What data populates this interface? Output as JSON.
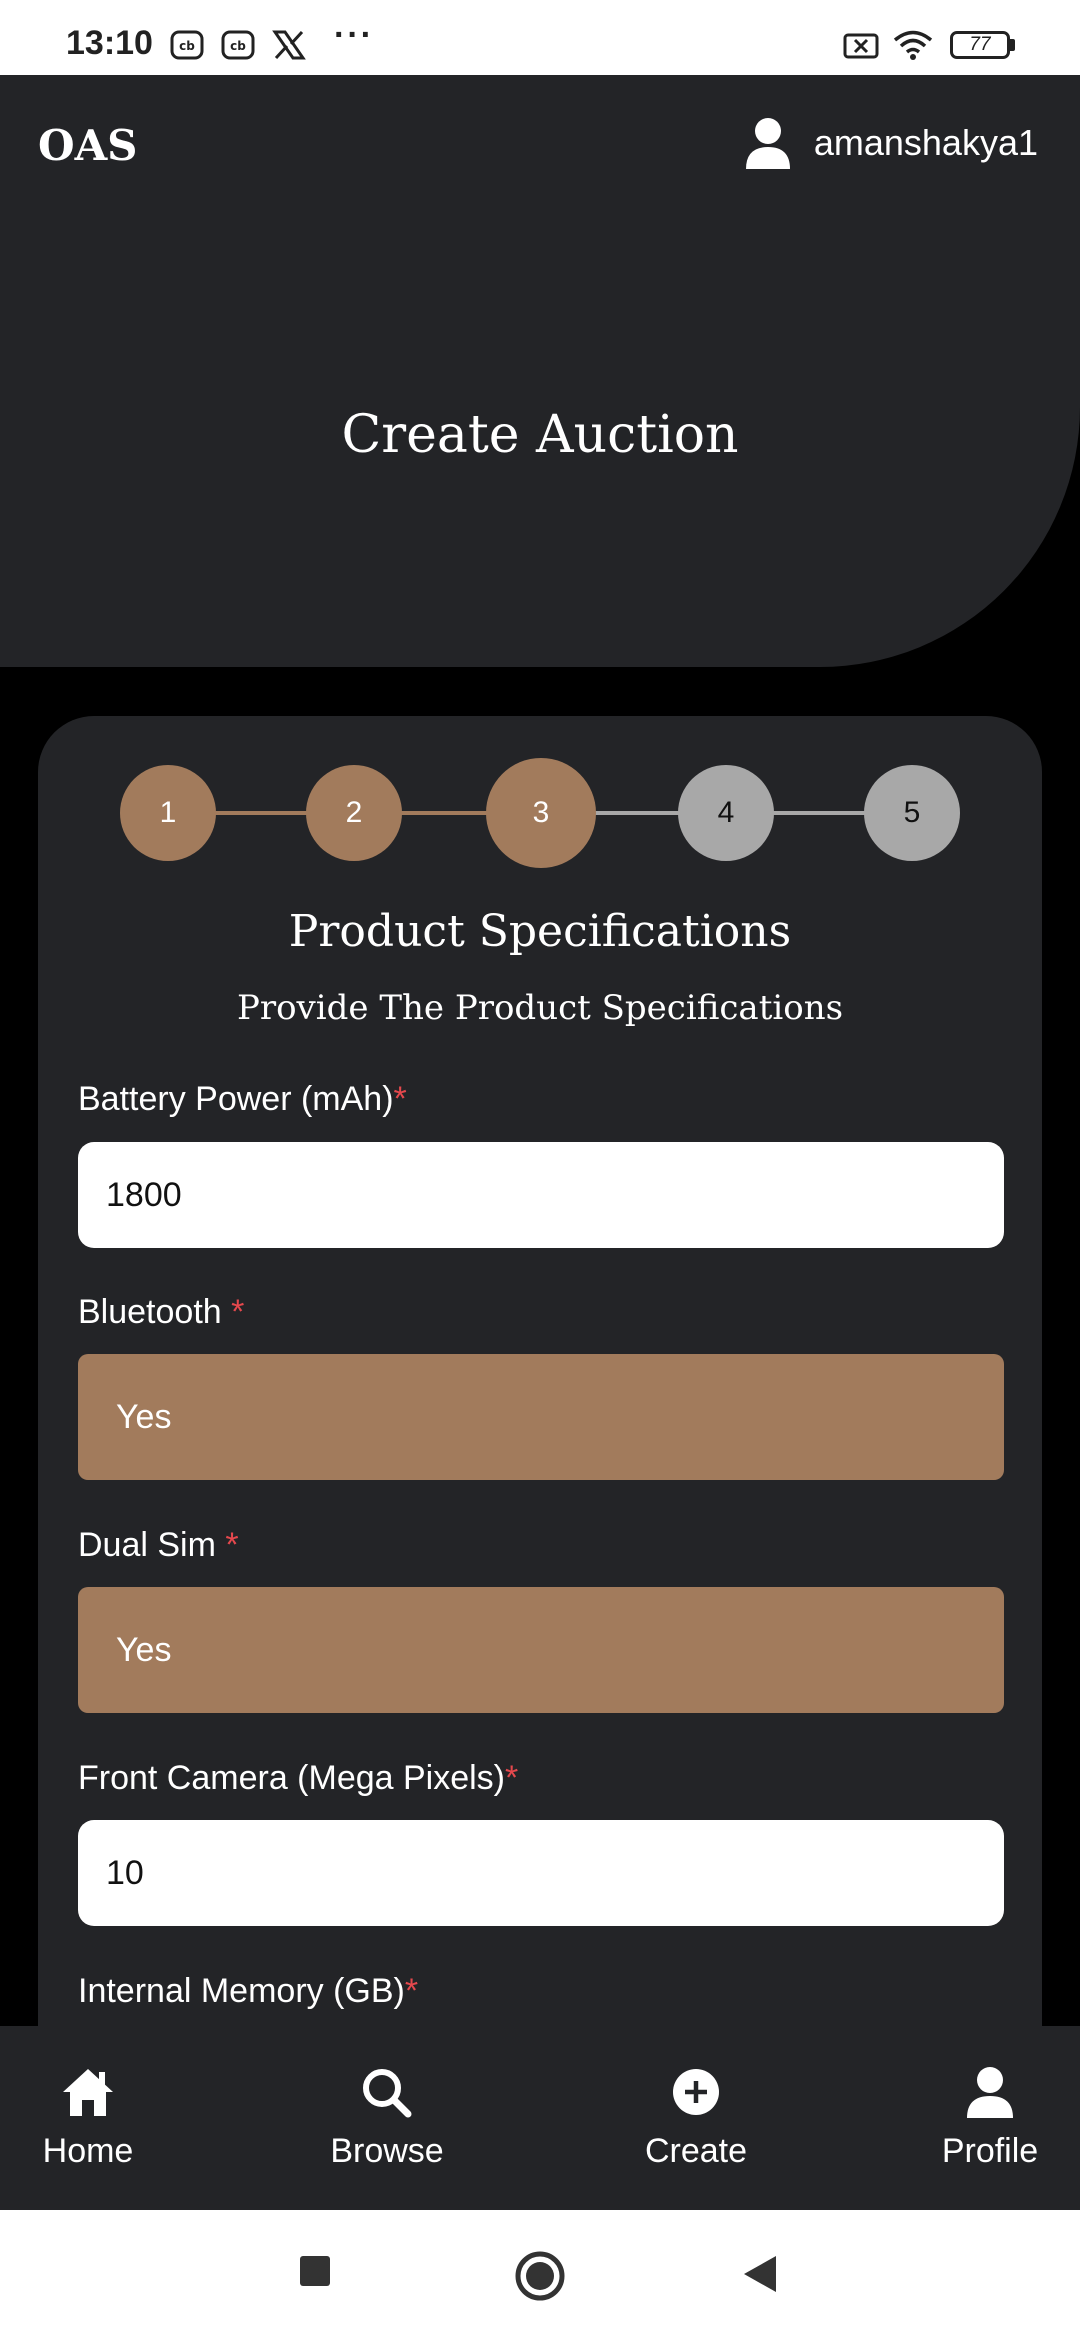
{
  "status_bar": {
    "time": "13:10",
    "dots": "···",
    "battery": "77",
    "icons": [
      "cb-icon",
      "cb-icon",
      "x-logo-icon",
      "more-dots-icon",
      "no-signal-icon",
      "wifi-icon",
      "battery-icon"
    ]
  },
  "header": {
    "logo": "OAS",
    "username": "amanshakya1",
    "user_icon": "user-icon"
  },
  "hero": {
    "title": "Create Auction"
  },
  "stepper": {
    "steps": [
      "1",
      "2",
      "3",
      "4",
      "5"
    ],
    "current": 3,
    "completed_color": "#a27b5c",
    "pending_color": "#a8a8a8"
  },
  "section": {
    "title": "Product Specifications",
    "subtitle": "Provide The Product Specifications"
  },
  "form": {
    "battery": {
      "label": "Battery Power (mAh)",
      "required": "*",
      "value": "1800"
    },
    "bluetooth": {
      "label": "Bluetooth ",
      "required": "*",
      "value": "Yes"
    },
    "dual_sim": {
      "label": "Dual Sim ",
      "required": "*",
      "value": "Yes"
    },
    "front_camera": {
      "label": "Front Camera (Mega Pixels)",
      "required": "*",
      "value": "10"
    },
    "internal_memory": {
      "label": "Internal Memory (GB)",
      "required": "*"
    }
  },
  "bottom_nav": {
    "items": [
      {
        "label": "Home",
        "icon": "home-icon"
      },
      {
        "label": "Browse",
        "icon": "search-icon"
      },
      {
        "label": "Create",
        "icon": "plus-circle-icon"
      },
      {
        "label": "Profile",
        "icon": "user-icon"
      }
    ]
  },
  "colors": {
    "background": "#000000",
    "surface": "#232427",
    "accent": "#a27b5c",
    "required": "#e5484d"
  }
}
